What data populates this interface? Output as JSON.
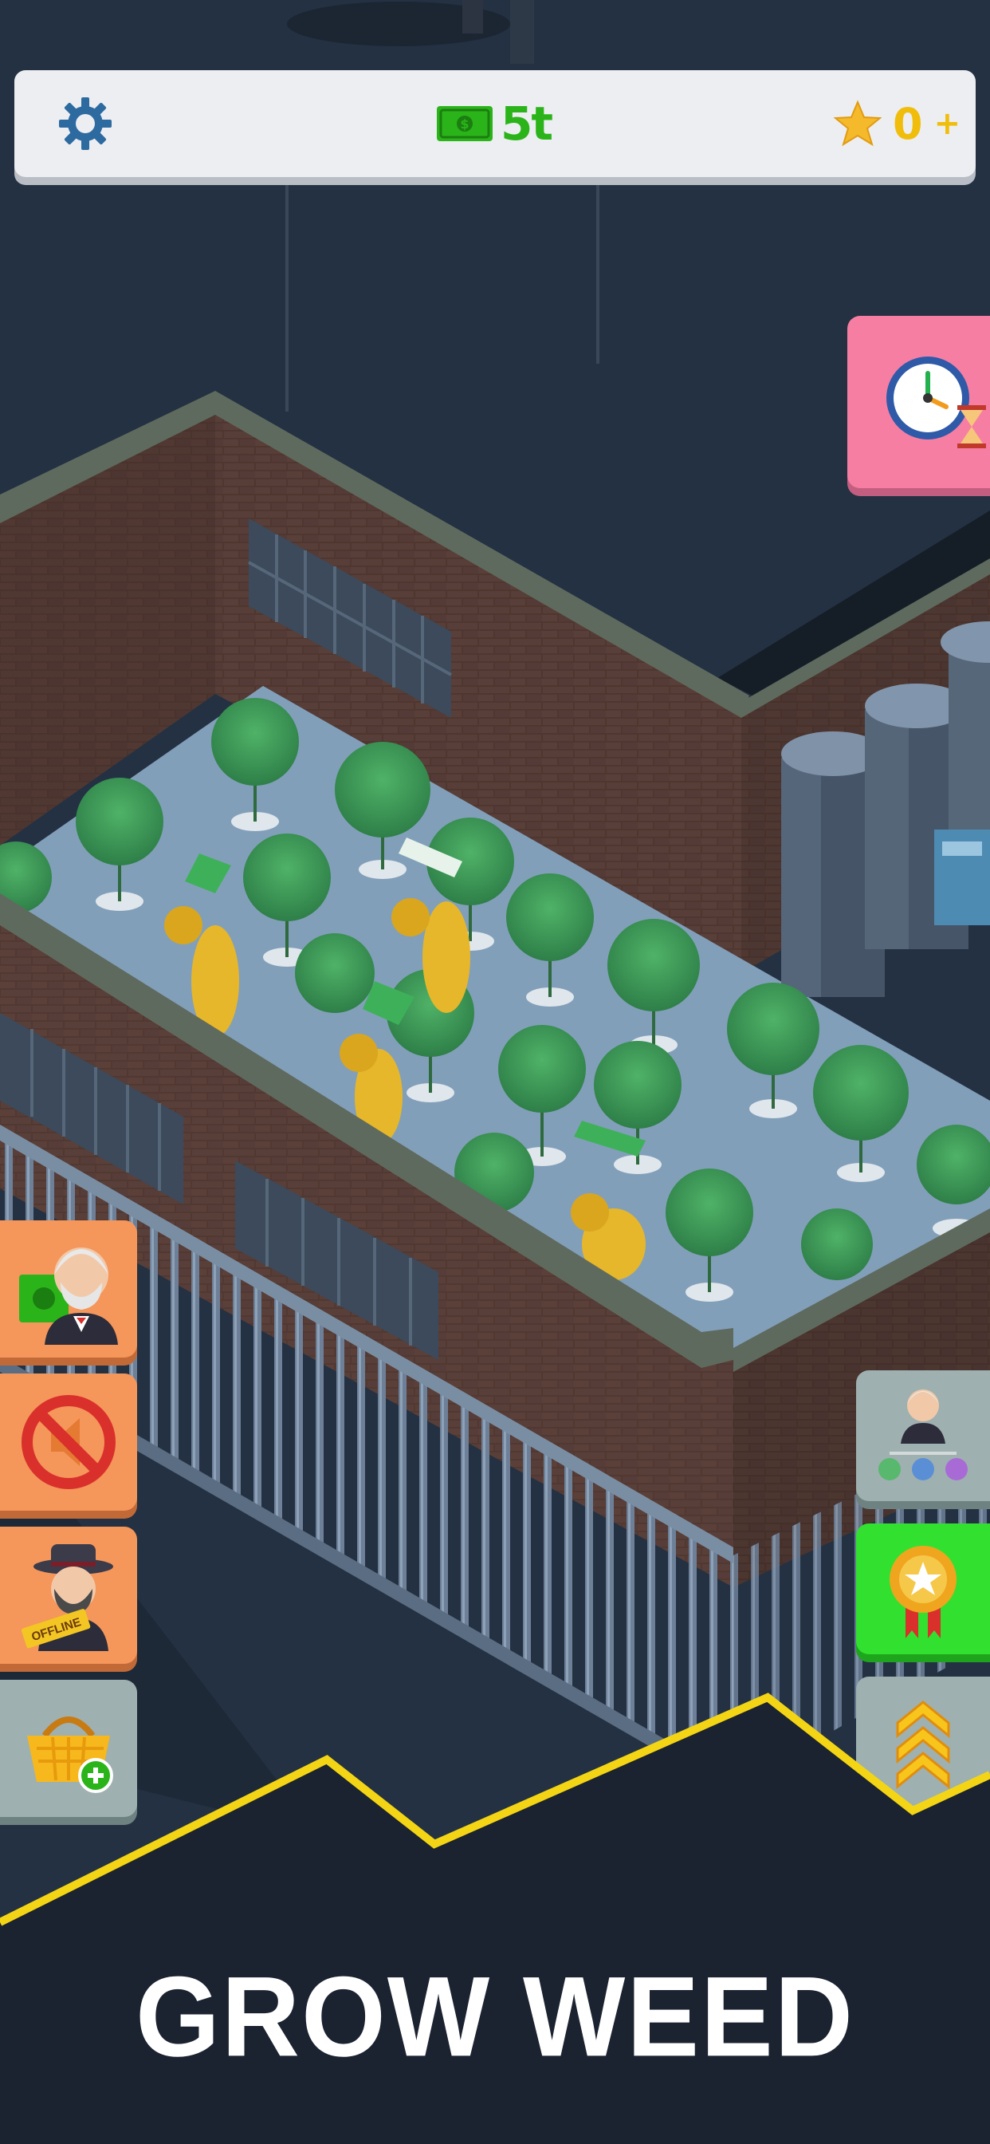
{
  "hud": {
    "settings_icon": "gear-icon",
    "cash_icon": "cash-bill-icon",
    "cash_value": "5t",
    "star_icon": "star-icon",
    "stars_value": "0",
    "stars_add_label": "+"
  },
  "buttons": {
    "timer": "clock-hourglass-icon",
    "left": [
      {
        "name": "manager-cash-boost",
        "icon": "manager-cash-icon"
      },
      {
        "name": "no-ads",
        "icon": "no-ads-icon"
      },
      {
        "name": "offline-earnings",
        "icon": "offline-manager-icon",
        "badge": "OFFLINE"
      },
      {
        "name": "shop",
        "icon": "basket-add-icon"
      }
    ],
    "right": [
      {
        "name": "managers-team",
        "icon": "manager-team-icon"
      },
      {
        "name": "achievements",
        "icon": "medal-icon"
      },
      {
        "name": "upgrades",
        "icon": "chevron-rank-icon"
      }
    ]
  },
  "banner": {
    "title": "GROW WEED"
  },
  "colors": {
    "background": "#243142",
    "cash": "#2bb41a",
    "stars": "#f1bd0c",
    "accent_line": "#f3d516"
  }
}
